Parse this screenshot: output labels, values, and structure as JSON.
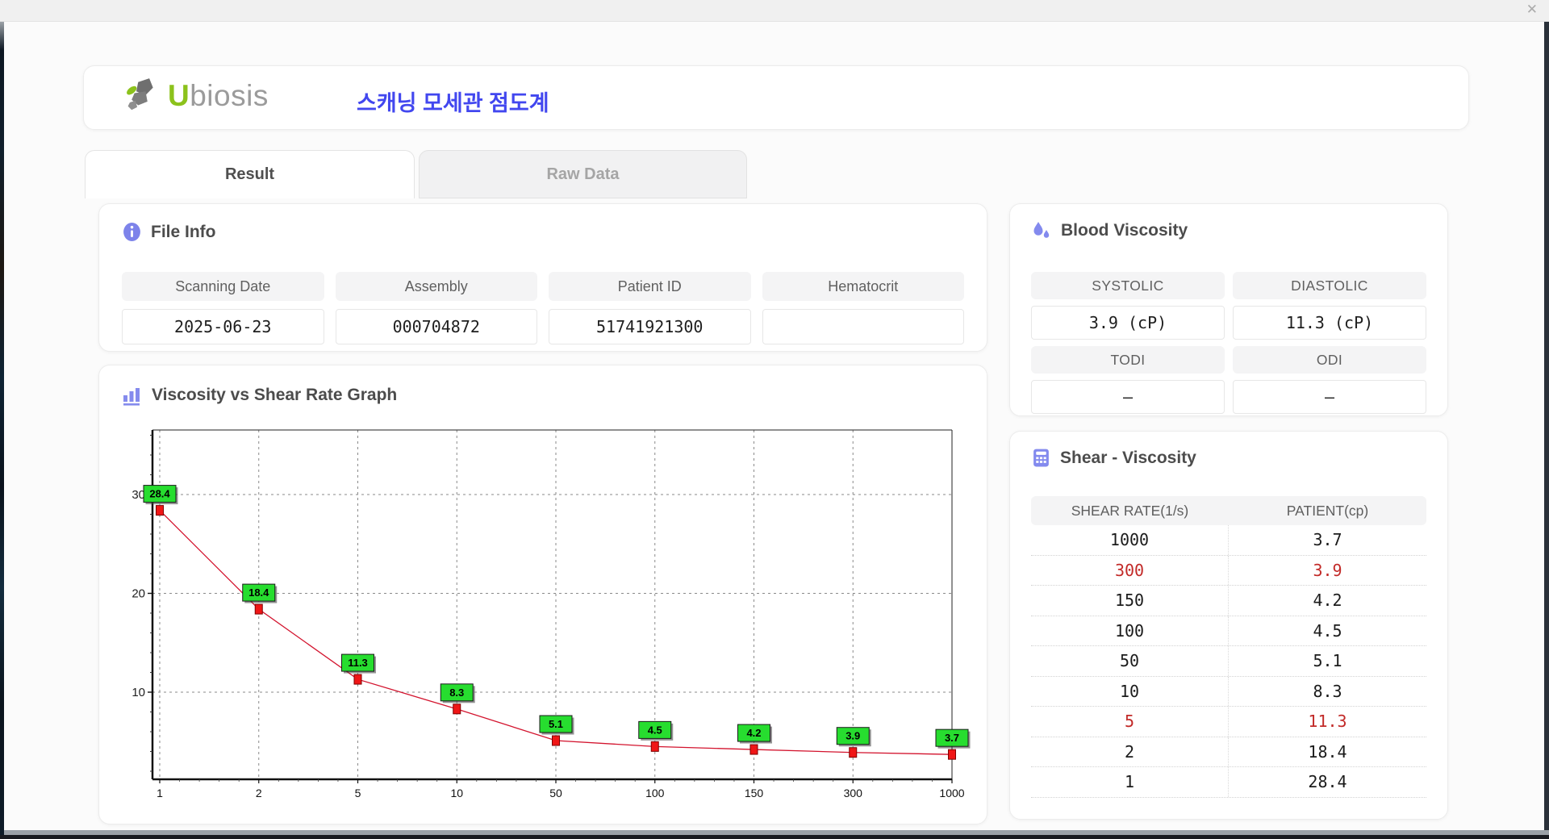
{
  "window": {
    "close_icon": "✕"
  },
  "header": {
    "brand": {
      "u": "U",
      "rest": "biosis"
    },
    "app_title": "스캐닝 모세관 점도계"
  },
  "tabs": {
    "result": "Result",
    "raw_data": "Raw Data"
  },
  "file_info": {
    "title": "File Info",
    "fields": [
      {
        "label": "Scanning Date",
        "value": "2025-06-23"
      },
      {
        "label": "Assembly",
        "value": "000704872"
      },
      {
        "label": "Patient ID",
        "value": "51741921300"
      },
      {
        "label": "Hematocrit",
        "value": ""
      }
    ]
  },
  "graph_section": {
    "title": "Viscosity vs Shear Rate Graph"
  },
  "blood_viscosity": {
    "title": "Blood Viscosity",
    "metrics": [
      {
        "label": "SYSTOLIC",
        "value": "3.9 (cP)"
      },
      {
        "label": "DIASTOLIC",
        "value": "11.3 (cP)"
      },
      {
        "label": "TODI",
        "value": "–"
      },
      {
        "label": "ODI",
        "value": "–"
      }
    ]
  },
  "shear_table": {
    "title": "Shear - Viscosity",
    "columns": [
      "SHEAR RATE(1/s)",
      "PATIENT(cp)"
    ],
    "rows": [
      [
        "1000",
        "3.7"
      ],
      [
        "300",
        "3.9"
      ],
      [
        "150",
        "4.2"
      ],
      [
        "100",
        "4.5"
      ],
      [
        "50",
        "5.1"
      ],
      [
        "10",
        "8.3"
      ],
      [
        "5",
        "11.3"
      ],
      [
        "2",
        "18.4"
      ],
      [
        "1",
        "28.4"
      ]
    ],
    "highlight_row_indexes": [
      1,
      6
    ]
  },
  "chart_data": {
    "type": "line",
    "title": "Viscosity vs Shear Rate Graph",
    "x": [
      1,
      2,
      5,
      10,
      50,
      100,
      150,
      300,
      1000
    ],
    "x_scale": "categorical-even",
    "series": [
      {
        "name": "PATIENT(cp)",
        "values": [
          28.4,
          18.4,
          11.3,
          8.3,
          5.1,
          4.5,
          4.2,
          3.9,
          3.7
        ]
      }
    ],
    "point_labels": [
      "28.4",
      "18.4",
      "11.3",
      "8.3",
      "5.1",
      "4.5",
      "4.2",
      "3.9",
      "3.7"
    ],
    "yticks": [
      10,
      20,
      30
    ],
    "ylim": [
      1.2,
      36.5
    ],
    "grid": "dashed",
    "legend": "none"
  },
  "colors": {
    "accent_icon": "#7f85ec",
    "title_blue": "#4247ef",
    "brand_green": "#8cc21c",
    "brand_gray": "#9b9b9b",
    "alert_red": "#c22a28",
    "chart_line": "#d3142e",
    "chart_marker": "#f01616",
    "chart_marker_border": "#7d0000",
    "chart_label_bg": "#27dd2f",
    "grid_gray": "#8a8a8a"
  }
}
